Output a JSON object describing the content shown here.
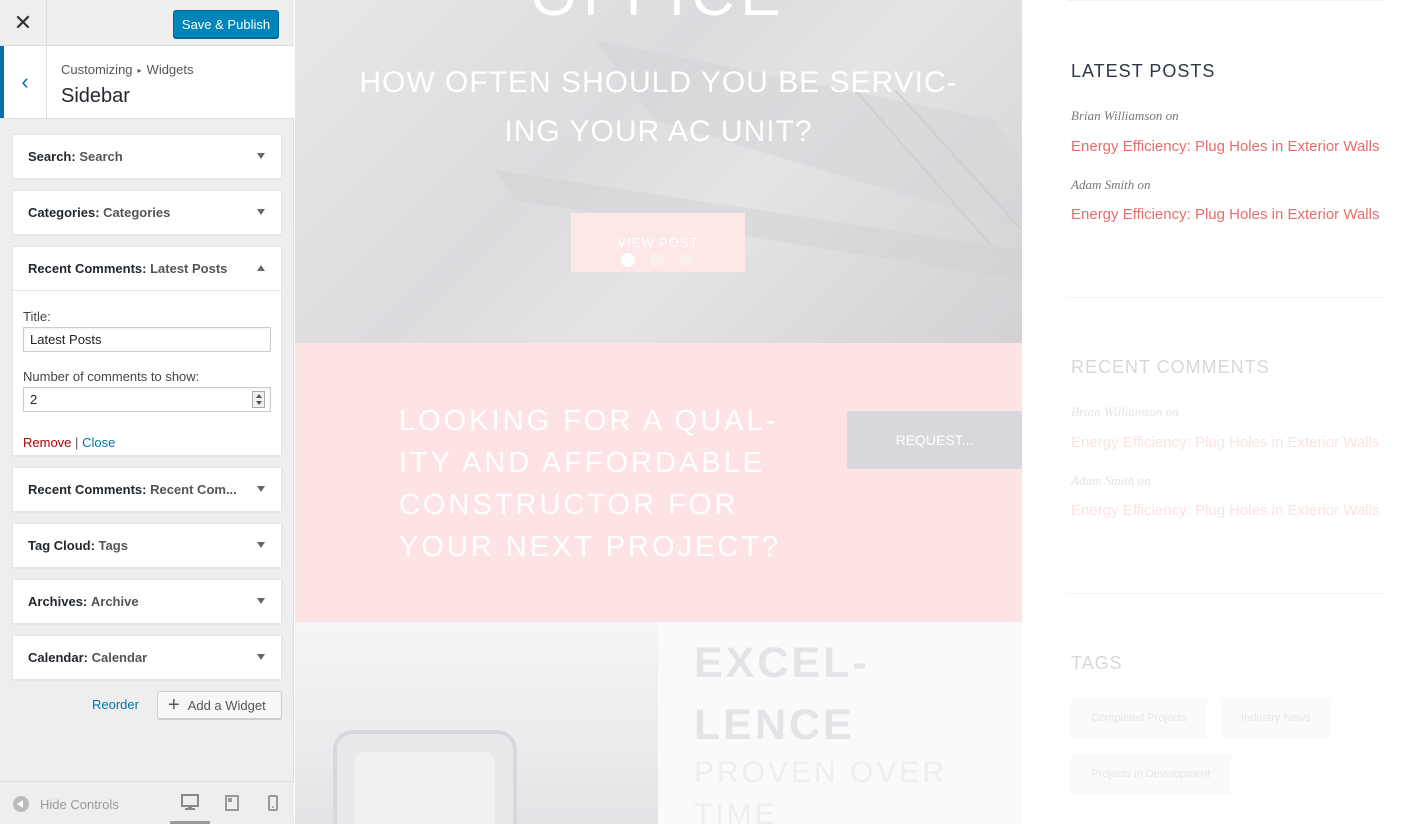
{
  "topbar": {
    "close_icon": "close-icon",
    "publish_label": "Save & Publish"
  },
  "section": {
    "breadcrumb_root": "Customizing",
    "breadcrumb_separator": "▸",
    "breadcrumb_parent": "Widgets",
    "name": "Sidebar"
  },
  "widgets": [
    {
      "name": "Search:",
      "title": "Search"
    },
    {
      "name": "Categories:",
      "title": "Categories"
    },
    {
      "name": "Recent Comments:",
      "title": "Latest Posts"
    },
    {
      "name": "Recent Comments:",
      "title": "Recent Com..."
    },
    {
      "name": "Tag Cloud:",
      "title": "Tags"
    },
    {
      "name": "Archives:",
      "title": "Archive"
    },
    {
      "name": "Calendar:",
      "title": "Calendar"
    }
  ],
  "expanded_widget": {
    "title_label": "Title:",
    "title_value": "Latest Posts",
    "number_label": "Number of comments to show:",
    "number_value": "2",
    "remove_label": "Remove",
    "separator": "|",
    "close_label": "Close"
  },
  "actions": {
    "reorder_label": "Reorder",
    "add_widget_label": "Add a Widget"
  },
  "footer": {
    "hide_controls_label": "Hide Controls",
    "devices": [
      "desktop",
      "tablet",
      "mobile"
    ],
    "active_device": "desktop"
  },
  "preview": {
    "hero_top_text": "OFFICE",
    "hero_title": "HOW OFTEN SHOULD YOU BE SERVIC-ING YOUR AC UNIT?",
    "hero_button": "VIEW POST",
    "slider_dots": 3,
    "slider_active": 1,
    "cta_text": "LOOKING FOR A QUAL-ITY AND AFFORDABLE CONSTRUCTOR FOR YOUR NEXT PROJECT?",
    "cta_button": "REQUEST...",
    "excellence_title": "EXCEL-LENCE",
    "excellence_sub": "PROVEN OVER TIME"
  },
  "sidebar_preview": {
    "latest_posts": {
      "heading": "LATEST POSTS",
      "items": [
        {
          "author": "Brian Williamson  on",
          "link": "Energy Efficiency: Plug Holes in Exterior Walls"
        },
        {
          "author": "Adam Smith  on",
          "link": "Energy Efficiency: Plug Holes in Exterior Walls"
        }
      ]
    },
    "recent_comments": {
      "heading": "RECENT COMMENTS",
      "items": [
        {
          "author": "Brian Williamson  on",
          "link": "Energy Efficiency: Plug Holes in Exterior Walls"
        },
        {
          "author": "Adam Smith  on",
          "link": "Energy Efficiency: Plug Holes in Exterior Walls"
        }
      ]
    },
    "tags": {
      "heading": "TAGS",
      "items": [
        "Completed Projects",
        "Industry News",
        "Projects in Development"
      ]
    }
  },
  "colors": {
    "accent": "#0073aa",
    "publish": "#0085ba",
    "link_red": "#e76c6c",
    "remove": "#aa0000"
  }
}
